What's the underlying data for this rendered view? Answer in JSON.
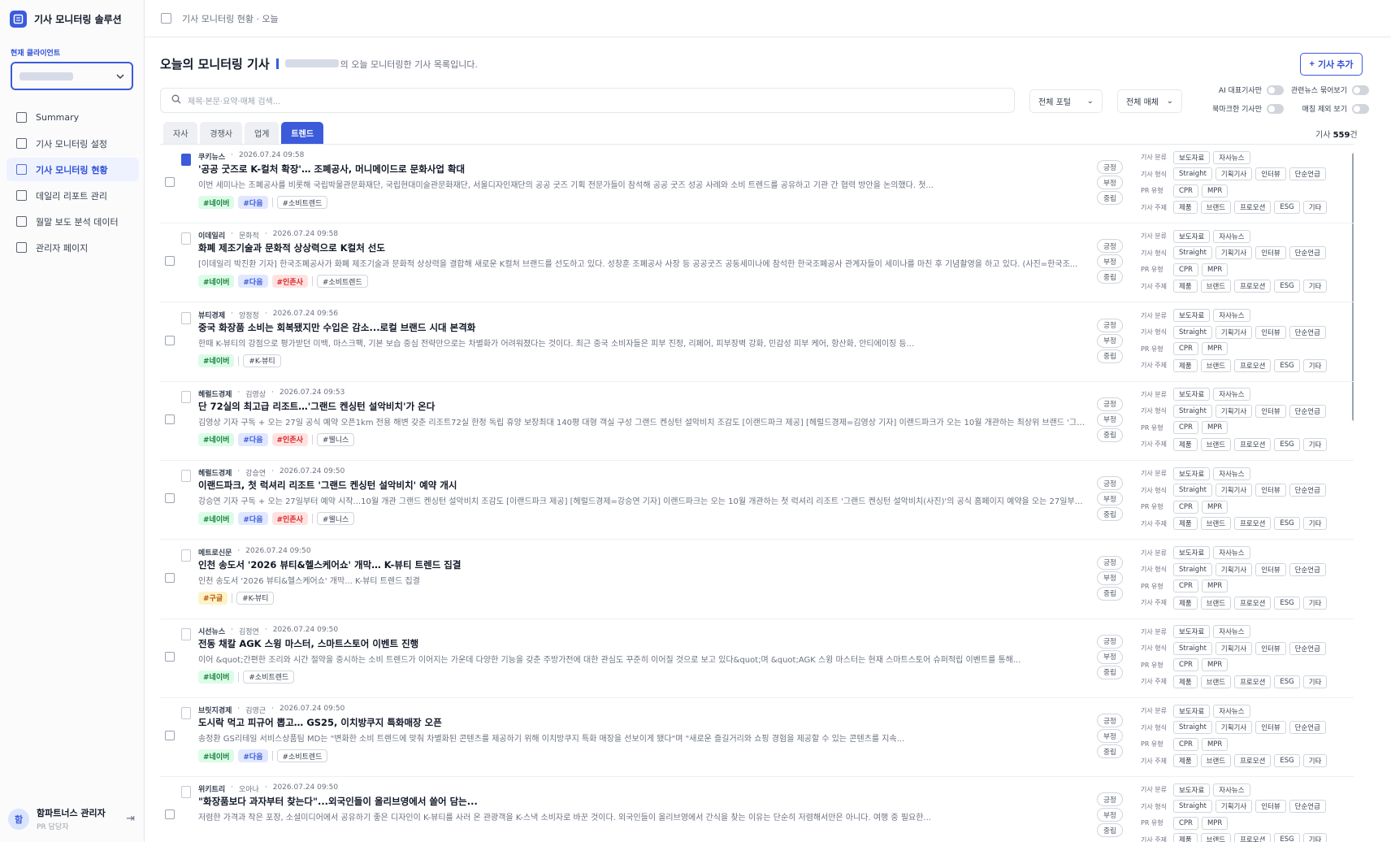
{
  "app": {
    "title": "기사 모니터링 솔루션",
    "client_label": "현재 클라이언트"
  },
  "nav": [
    {
      "label": "Summary",
      "icon": "bar-chart-icon",
      "active": false
    },
    {
      "label": "기사 모니터링 설정",
      "icon": "gear-icon",
      "active": false
    },
    {
      "label": "기사 모니터링 현황",
      "icon": "news-icon",
      "active": true
    },
    {
      "label": "데일리 리포트 관리",
      "icon": "document-icon",
      "active": false
    },
    {
      "label": "월말 보도 분석 데이터",
      "icon": "calendar-icon",
      "active": false
    },
    {
      "label": "관리자 페이지",
      "icon": "shield-icon",
      "active": false
    }
  ],
  "user": {
    "avatar": "함",
    "name": "함파트너스 관리자",
    "role": "PR 담당자"
  },
  "topbar": {
    "breadcrumb": "기사 모니터링 현황 · 오늘"
  },
  "page": {
    "title": "오늘의 모니터링 기사",
    "subtitle": "의 오늘 모니터링한 기사 목록입니다.",
    "add_label": "기사 추가"
  },
  "filters": {
    "search_placeholder": "제목·본문·요약·매체 검색...",
    "portal": "전체 포털",
    "media": "전체 매체"
  },
  "toggles": [
    "AI 대표기사만",
    "관련뉴스 묶어보기",
    "북마크한 기사만",
    "매칭 제외 보기"
  ],
  "tabs": [
    {
      "label": "자사",
      "active": false
    },
    {
      "label": "경쟁사",
      "active": false
    },
    {
      "label": "업계",
      "active": false
    },
    {
      "label": "트렌드",
      "active": true
    }
  ],
  "count": {
    "prefix": "기사",
    "value": "559",
    "suffix": "건"
  },
  "sentiments": [
    "긍정",
    "부정",
    "중립"
  ],
  "classification": {
    "labels": [
      "기사 분류",
      "기사 형식",
      "PR 유형",
      "기사 주제"
    ],
    "rows": [
      [
        "보도자료",
        "자사뉴스"
      ],
      [
        "Straight",
        "기획기사",
        "인터뷰",
        "단순언급"
      ],
      [
        "CPR",
        "MPR"
      ],
      [
        "제품",
        "브랜드",
        "프로모션",
        "ESG",
        "기타"
      ]
    ]
  },
  "articles": [
    {
      "source": "쿠키뉴스",
      "reporter": "",
      "time": "2026.07.24 09:58",
      "bookmarked": true,
      "title": "'공공 굿즈로 K-컬처 확장'… 조폐공사, 머니메이드로 문화사업 확대",
      "summary": "이번 세미나는 조폐공사를 비롯해 국립박물관문화재단, 국립현대미술관문화재단, 서울디자인재단의 공공 굿즈 기획 전문가들이 참석해 공공 굿즈 성공 사례와 소비 트렌드를 공유하고 기관 간 협력 방안을 논의했다. 첫...",
      "portals": [
        {
          "label": "#네이버",
          "type": "naver"
        },
        {
          "label": "#다음",
          "type": "daum"
        }
      ],
      "keywords": [
        "#소비트렌드"
      ]
    },
    {
      "source": "이데일리",
      "reporter": "문화적",
      "time": "2026.07.24 09:58",
      "bookmarked": false,
      "title": "화폐 제조기술과 문화적 상상력으로 K컬처 선도",
      "summary": "[이데일리 박진환 기자] 한국조폐공사가 화폐 제조기술과 문화적 상상력을 결합해 새로운 K컬처 브랜드를 선도하고 있다. 성창훈 조폐공사 사장 등 공공굿즈 공동세미나에 참석한 한국조폐공사 관계자들이 세미나를 마친 후 기념촬영을 하고 있다. (사진=한국조...",
      "portals": [
        {
          "label": "#네이버",
          "type": "naver"
        },
        {
          "label": "#다음",
          "type": "daum"
        },
        {
          "label": "#인존사",
          "type": "injoy"
        }
      ],
      "keywords": [
        "#소비트렌드"
      ]
    },
    {
      "source": "뷰티경제",
      "reporter": "앙정정",
      "time": "2026.07.24 09:56",
      "bookmarked": false,
      "title": "중국 화장품 소비는 회복됐지만 수입은 감소...로컬 브랜드 시대 본격화",
      "summary": "한때 K-뷰티의 강점으로 평가받던 미백, 마스크팩, 기본 보습 중심 전략만으로는 차별화가 어려워졌다는 것이다. 최근 중국 소비자들은 피부 진정, 리페어, 피부장벽 강화, 민감성 피부 케어, 항산화, 안티에이징 등...",
      "portals": [
        {
          "label": "#네이버",
          "type": "naver"
        }
      ],
      "keywords": [
        "#K-뷰티"
      ]
    },
    {
      "source": "헤럴드경제",
      "reporter": "김영상",
      "time": "2026.07.24 09:53",
      "bookmarked": false,
      "title": "단 72실의 최고급 리조트…'그랜드 켄싱턴 설악비치'가 온다",
      "summary": "김영상 기자 구독 + 오는 27일 공식 예약 오픈1km 전용 해변 갖춘 리조트72실 한정 독립 휴양 보장최대 140평 대형 객실 구성 그랜드 켄싱턴 설악비치 조감도 [이랜드파크 제공] [헤럴드경제=김영상 기자] 이랜드파크가 오는 10월 개관하는 최상위 브랜드 '그랜...",
      "portals": [
        {
          "label": "#네이버",
          "type": "naver"
        },
        {
          "label": "#다음",
          "type": "daum"
        },
        {
          "label": "#인존사",
          "type": "injoy"
        }
      ],
      "keywords": [
        "#웰니스"
      ]
    },
    {
      "source": "헤럴드경제",
      "reporter": "강승연",
      "time": "2026.07.24 09:50",
      "bookmarked": false,
      "title": "이랜드파크, 첫 럭셔리 리조트 '그랜드 켄싱턴 설악비치' 예약 개시",
      "summary": "강승연 기자 구독 + 오는 27일부터 예약 시작...10월 개관 그랜드 켄싱턴 설악비치 조감도 [이랜드파크 제공] [헤럴드경제=강승연 기자] 이랜드파크는 오는 10월 개관하는 첫 럭셔리 리조트 '그랜드 켄싱턴 설악비치(사진)'의 공식 홈페이지 예약을 오는 27일부터...",
      "portals": [
        {
          "label": "#네이버",
          "type": "naver"
        },
        {
          "label": "#다음",
          "type": "daum"
        },
        {
          "label": "#인존사",
          "type": "injoy"
        }
      ],
      "keywords": [
        "#웰니스"
      ]
    },
    {
      "source": "메트로신문",
      "reporter": "",
      "time": "2026.07.24 09:50",
      "bookmarked": false,
      "title": "인천 송도서 '2026 뷰티&헬스케어쇼' 개막… K-뷰티 트렌드 집결",
      "summary": "인천 송도서 '2026 뷰티&헬스케어쇼' 개막... K-뷰티 트렌드 집결",
      "portals": [
        {
          "label": "#구글",
          "type": "google"
        }
      ],
      "keywords": [
        "#K-뷰티"
      ]
    },
    {
      "source": "시선뉴스",
      "reporter": "김정연",
      "time": "2026.07.24 09:50",
      "bookmarked": false,
      "title": "전동 채칼 AGK 스윙 마스터, 스마트스토어 이벤트 진행",
      "summary": "이어 &quot;간편한 조리와 시간 절약을 중시하는 소비 트렌드가 이어지는 가운데 다양한 기능을 갖춘 주방가전에 대한 관심도 꾸준히 이어질 것으로 보고 있다&quot;며 &quot;AGK 스윙 마스터는 현재 스마트스토어 슈퍼적립 이벤트를 통해...",
      "portals": [
        {
          "label": "#네이버",
          "type": "naver"
        }
      ],
      "keywords": [
        "#소비트렌드"
      ]
    },
    {
      "source": "브릿지경제",
      "reporter": "김영근",
      "time": "2026.07.24 09:50",
      "bookmarked": false,
      "title": "도시락 먹고 피규어 뽑고… GS25, 이치방쿠지 특화매장 오픈",
      "summary": "송정환 GS리테일 서비스상품팀 MD는 \"변화한 소비 트렌드에 맞춰 차별화된 콘텐츠를 제공하기 위해 이치방쿠지 특화 매장을 선보이게 됐다\"며 \"새로운 즐길거리와 쇼핑 경험을 제공할 수 있는 콘텐츠를 지속...",
      "portals": [
        {
          "label": "#네이버",
          "type": "naver"
        },
        {
          "label": "#다음",
          "type": "daum"
        }
      ],
      "keywords": [
        "#소비트렌드"
      ]
    },
    {
      "source": "위키트리",
      "reporter": "오아나",
      "time": "2026.07.24 09:50",
      "bookmarked": false,
      "title": "\"화장품보다 과자부터 찾는다\"...외국인들이 올리브영에서 쓸어 담는...",
      "summary": "저렴한 가격과 작은 포장, 소셜미디어에서 공유하기 좋은 디자인이 K-뷰티를 사러 온 관광객을 K-스낵 소비자로 바꾼 것이다. 외국인들이 올리브영에서 간식을 찾는 이유는 단순히 저렴해서만은 아니다. 여행 중 필요한...",
      "portals": [],
      "keywords": []
    }
  ]
}
